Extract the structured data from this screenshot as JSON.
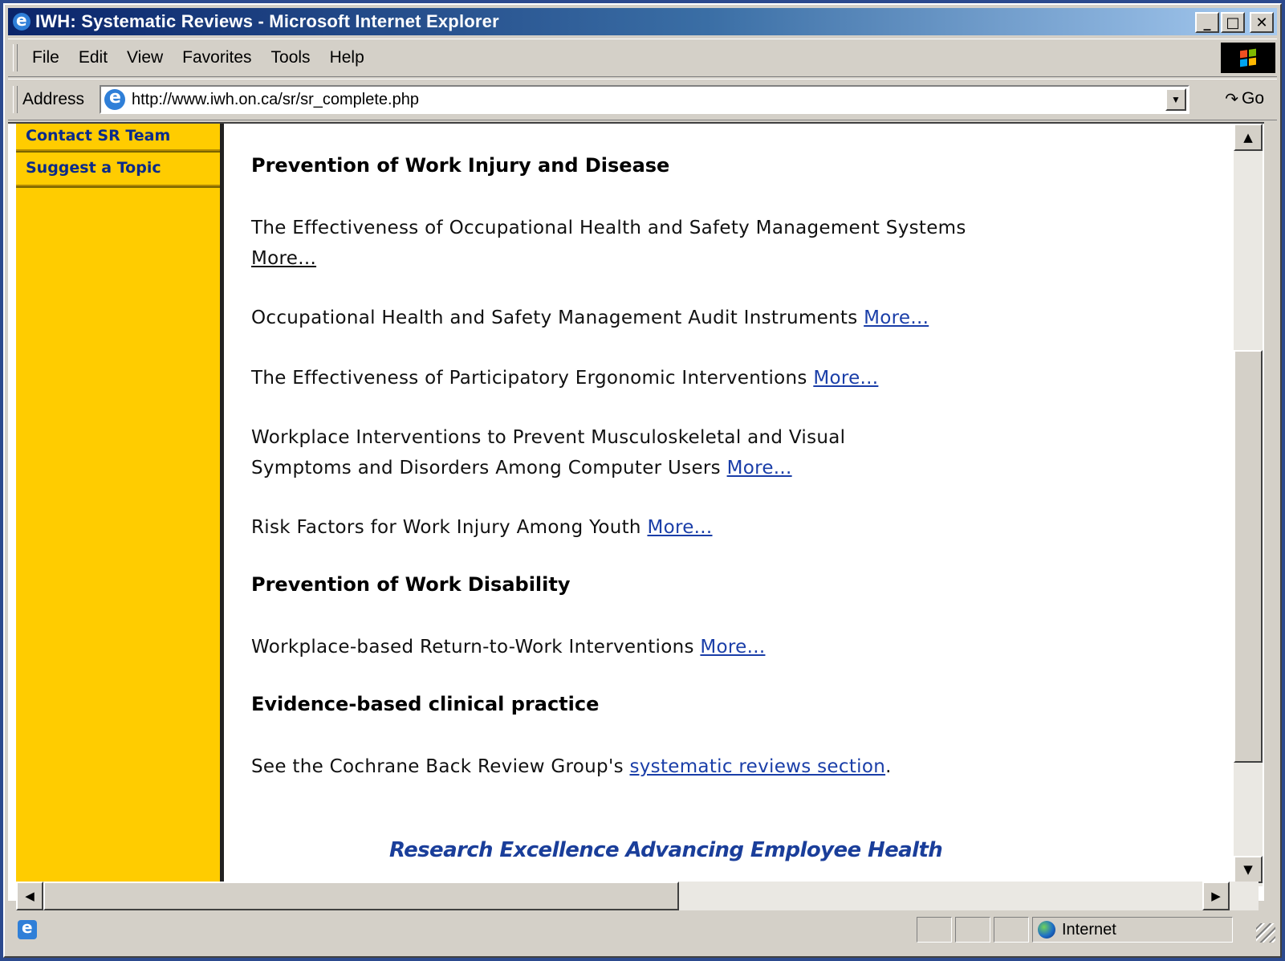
{
  "window": {
    "title": "IWH: Systematic Reviews - Microsoft Internet Explorer",
    "buttons": {
      "minimize": "_",
      "maximize": "□",
      "close": "✕"
    }
  },
  "menu": [
    "File",
    "Edit",
    "View",
    "Favorites",
    "Tools",
    "Help"
  ],
  "address": {
    "label": "Address",
    "url": "http://www.iwh.on.ca/sr/sr_complete.php",
    "go_label": "Go"
  },
  "sidebar": {
    "items": [
      "Contact SR Team",
      "Suggest a Topic"
    ]
  },
  "content": {
    "sections": [
      {
        "heading": "Prevention of Work Injury and Disease",
        "entries": [
          {
            "text": "The Effectiveness of Occupational Health and Safety Management Systems",
            "link": "More...",
            "visited": true
          },
          {
            "text": "Occupational Health and Safety Management Audit Instruments",
            "link": "More...",
            "visited": false
          },
          {
            "text": "The Effectiveness of Participatory Ergonomic Interventions",
            "link": "More...",
            "visited": false
          },
          {
            "text": "Workplace Interventions to Prevent Musculoskeletal and Visual Symptoms and Disorders Among Computer Users",
            "link": "More...",
            "visited": false
          },
          {
            "text": "Risk Factors for Work Injury Among Youth",
            "link": "More...",
            "visited": false
          }
        ]
      },
      {
        "heading": "Prevention of Work Disability",
        "entries": [
          {
            "text": "Workplace-based Return-to-Work Interventions",
            "link": "More...",
            "visited": false
          }
        ]
      },
      {
        "heading": "Evidence-based clinical practice",
        "entries": [
          {
            "text": "See the Cochrane Back Review Group's",
            "link": "systematic reviews section",
            "suffix": "."
          }
        ]
      }
    ],
    "footer_tagline": "Research Excellence Advancing Employee Health"
  },
  "status": {
    "zone": "Internet"
  },
  "scroll": {
    "vertical_fraction": 0.75,
    "horizontal_fraction": 0.0
  }
}
